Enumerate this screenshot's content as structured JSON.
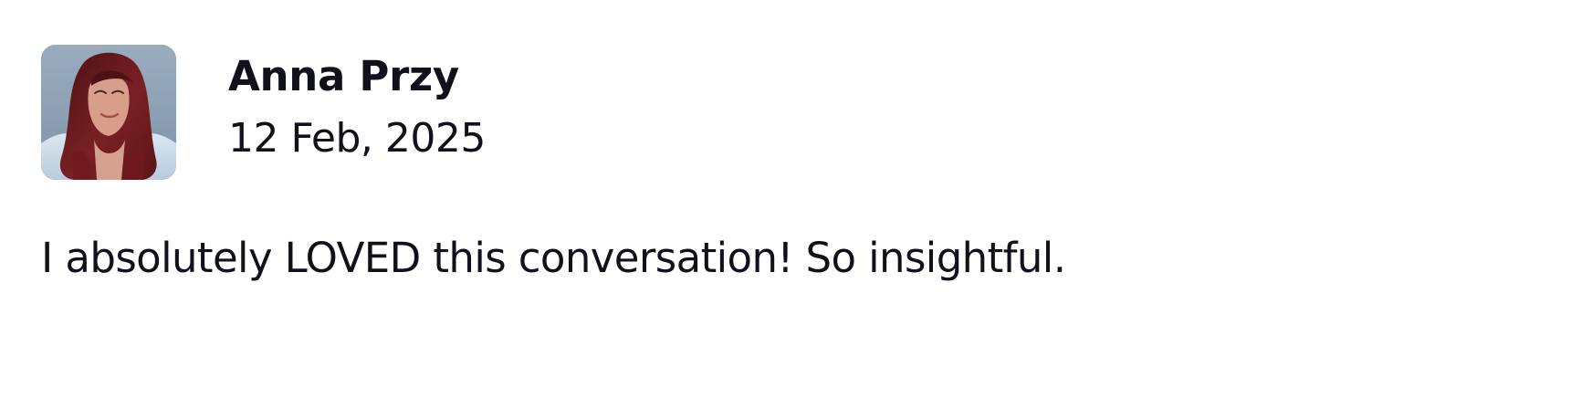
{
  "comment": {
    "author": "Anna Przy",
    "date": "12 Feb, 2025",
    "text": "I absolutely LOVED this conversation! So insightful.",
    "avatar": {
      "icon": "user-avatar-photo",
      "background": "#8d9fb4",
      "hair": "#6b1d1f",
      "skin": "#d99d8b",
      "shirt": "#c9d9e7"
    }
  }
}
